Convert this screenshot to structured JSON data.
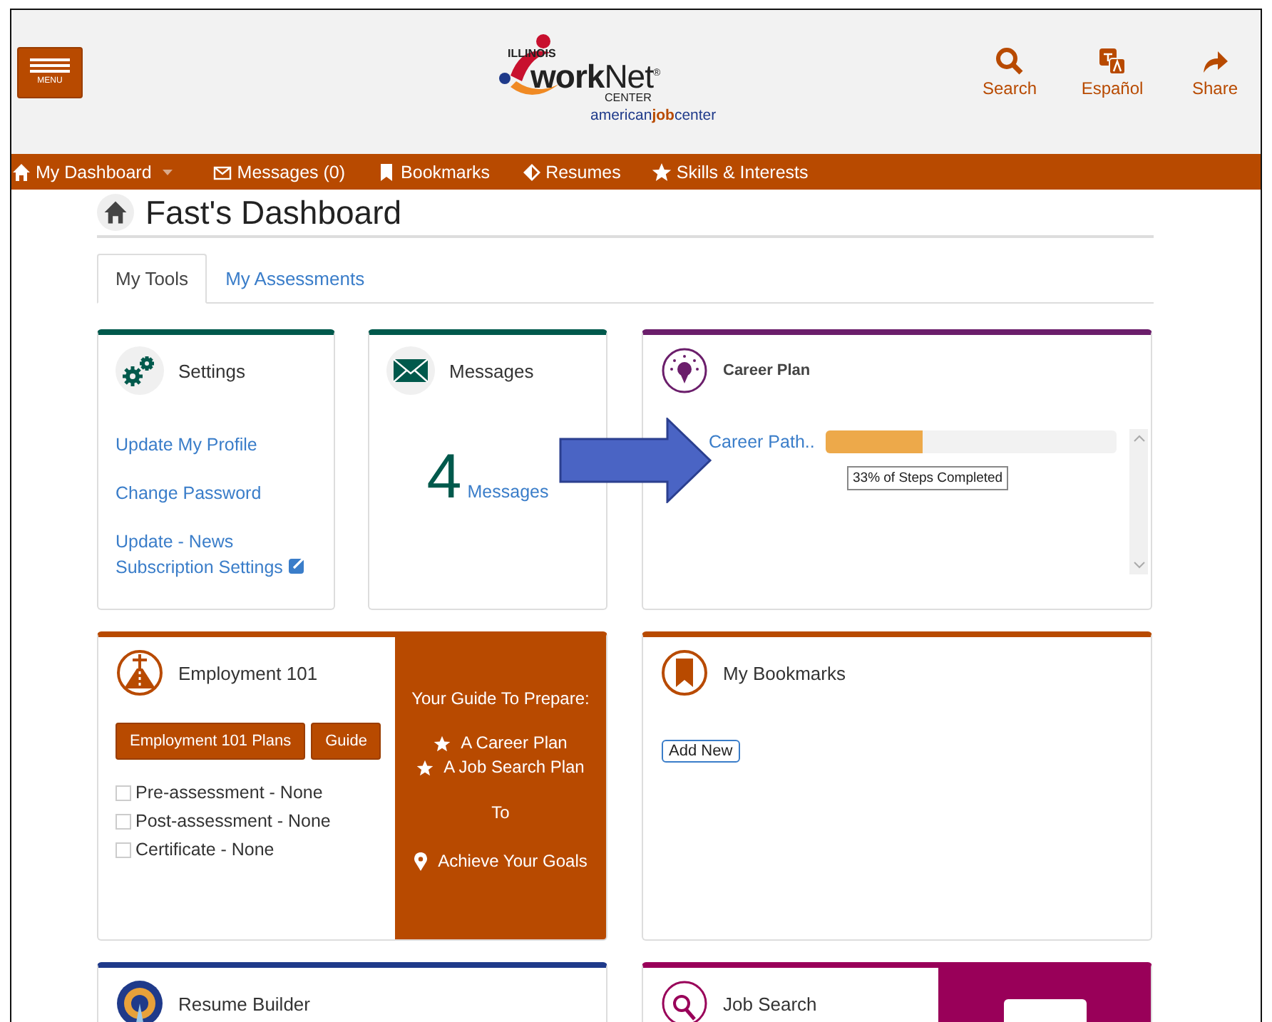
{
  "header": {
    "menu_button": "MENU",
    "logo": {
      "state": "ILLINOIS",
      "brand": "**work**Net$^{®}$",
      "center": "CENTER",
      "tagline": "american**job**center"
    },
    "actions": [
      {
        "label": "Search",
        "kind": "search"
      },
      {
        "label": "Español",
        "kind": "language"
      },
      {
        "label": "Share",
        "kind": "share"
      }
    ]
  },
  "nav": [
    {
      "label": "My Dashboard",
      "kind": "home",
      "has_menu": true
    },
    {
      "label": "Messages (0)",
      "kind": "mail",
      "has_menu": false
    },
    {
      "label": "Bookmarks",
      "kind": "bookmark",
      "has_menu": false
    },
    {
      "label": "Resumes",
      "kind": "diamond",
      "has_menu": false
    },
    {
      "label": "Skills & Interests",
      "kind": "star",
      "has_menu": false
    }
  ],
  "page_title": "Fast's Dashboard",
  "tabs": [
    {
      "label": "My Tools",
      "selected": true
    },
    {
      "label": "My Assessments",
      "selected": false
    }
  ],
  "cards": [
    {
      "kind": "links",
      "title": "Settings",
      "color": "#00594c",
      "links": [
        {
          "label": "Update My Profile",
          "external": false
        },
        {
          "label": "Change Password",
          "external": false
        },
        {
          "label": "Update - News Subscription Settings",
          "external": true
        }
      ]
    },
    {
      "kind": "count",
      "title": "Messages",
      "color": "#00594c",
      "count": "4",
      "link": "Messages"
    },
    {
      "kind": "progress",
      "title": "Career Plan",
      "color": "#6b1e6b",
      "item": "Career Path..",
      "level": 0.33,
      "tooltip": "33% of Steps Completed"
    },
    {
      "kind": "guide",
      "title": "Employment 101",
      "color": "#b84a00",
      "buttons": [
        "Employment 101 Plans",
        "Guide"
      ],
      "checklist": [
        {
          "label": "Pre-assessment - None",
          "checked": false
        },
        {
          "label": "Post-assessment - None",
          "checked": false
        },
        {
          "label": "Certificate - None",
          "checked": false
        }
      ],
      "panel": {
        "heading": "Your Guide To Prepare:",
        "goals": [
          "A Career Plan",
          "A Job Search Plan"
        ],
        "joiner": "To",
        "target": "Achieve Your Goals"
      }
    },
    {
      "kind": "bookmarks",
      "title": "My Bookmarks",
      "color": "#b84a00",
      "button": "Add New"
    },
    {
      "kind": "plain",
      "title": "Resume Builder",
      "color": "#1f3a8a"
    },
    {
      "kind": "side",
      "title": "Job Search",
      "color": "#990059"
    }
  ]
}
